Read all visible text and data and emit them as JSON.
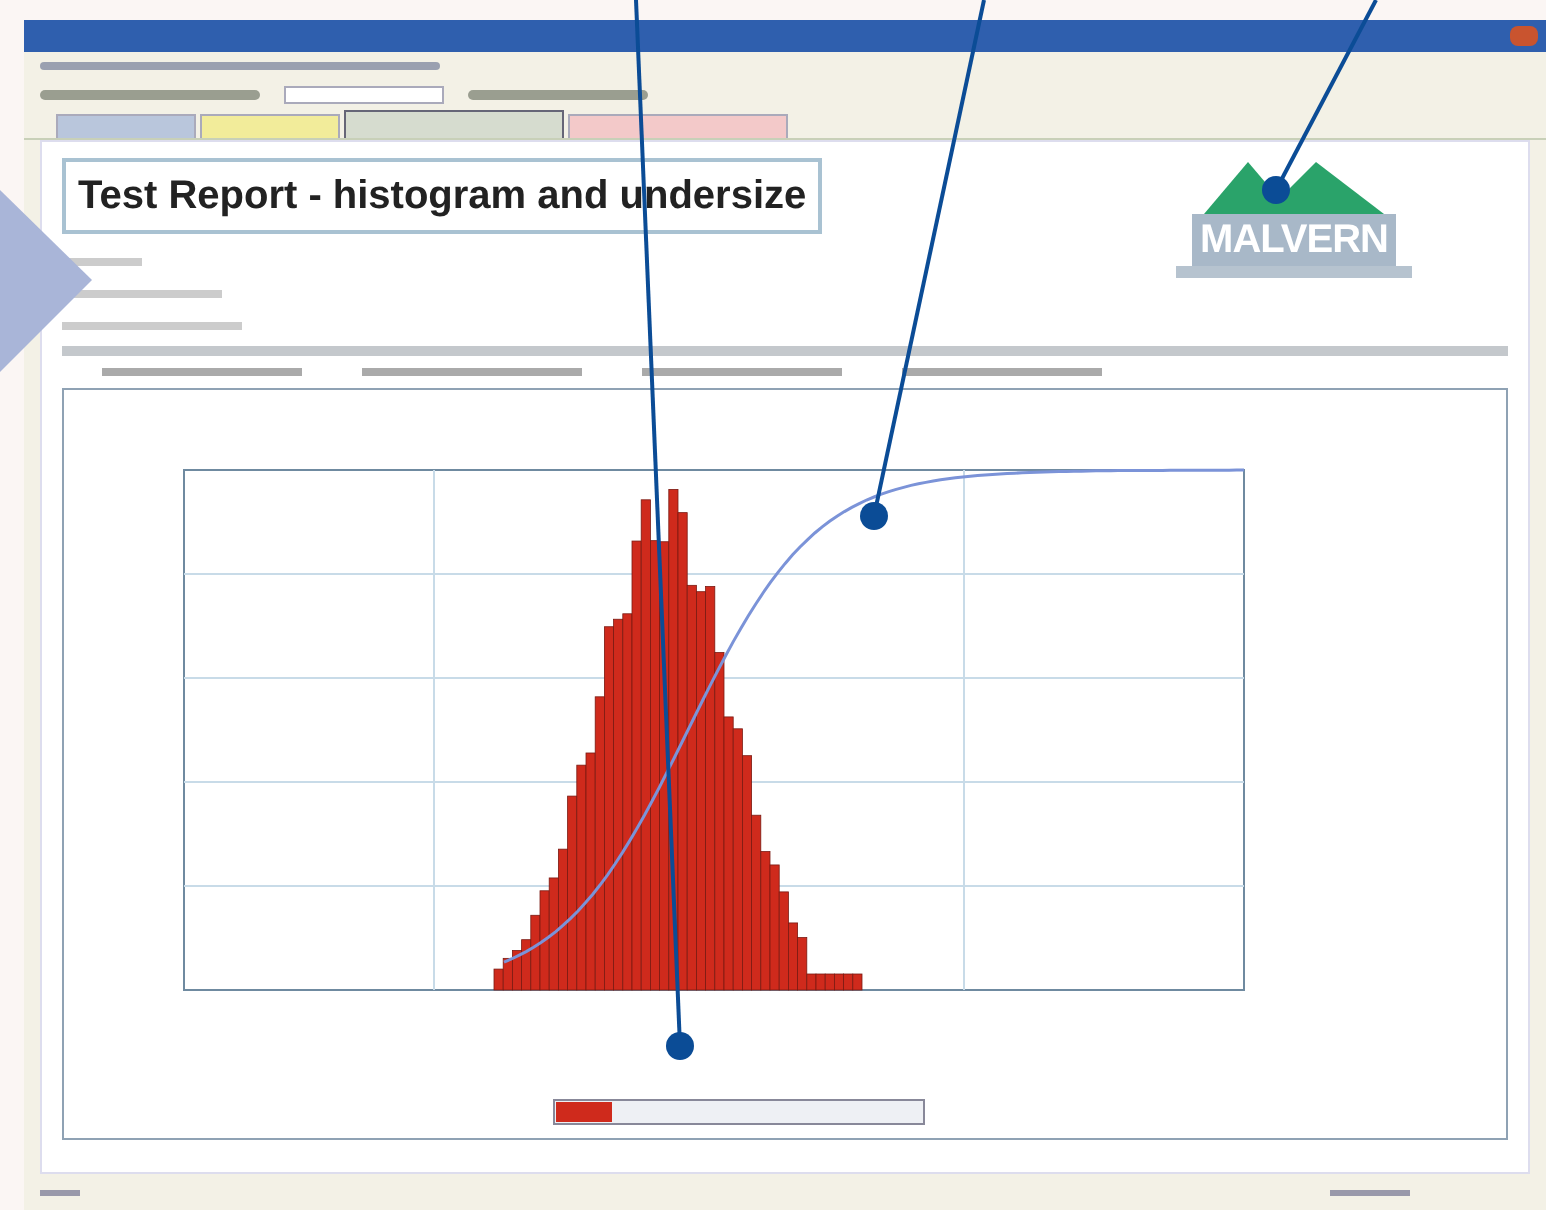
{
  "tabs": [
    {
      "color": "#b9c6dc",
      "selected": false
    },
    {
      "color": "#f2ec9a",
      "selected": false
    },
    {
      "color": "#d6dccf",
      "selected": true
    },
    {
      "color": "#f3c9c9",
      "selected": false
    }
  ],
  "report": {
    "title": "Test Report - histogram and undersize"
  },
  "logo": {
    "text": "MALVERN"
  }
}
